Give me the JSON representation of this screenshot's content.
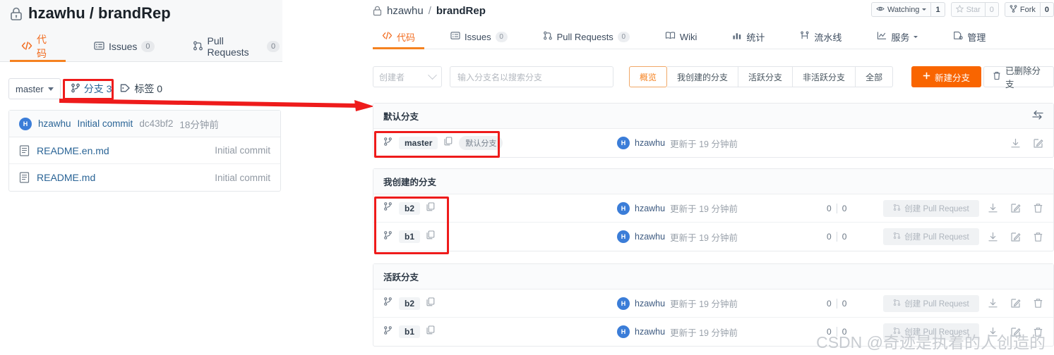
{
  "left_panel": {
    "title": "hzawhu / brandRep",
    "lock_icon": "lock-icon",
    "tabs": [
      {
        "label": "代码",
        "icon": "code-icon",
        "count": null,
        "active": true
      },
      {
        "label": "Issues",
        "icon": "issues-icon",
        "count": "0",
        "active": false
      },
      {
        "label": "Pull Requests",
        "icon": "pull-request-icon",
        "count": "0",
        "active": false
      }
    ],
    "toolbar": {
      "branch_select": "master",
      "branches_label": "分支 3",
      "tags_label": "标签 0"
    },
    "commit_row": {
      "avatar_initial": "H",
      "author": "hzawhu",
      "message": "Initial commit",
      "hash": "dc43bf2",
      "time": "18分钟前"
    },
    "files": [
      {
        "name": "README.en.md",
        "message": "Initial commit",
        "icon": "file-icon"
      },
      {
        "name": "README.md",
        "message": "Initial commit",
        "icon": "file-icon"
      }
    ]
  },
  "right_panel": {
    "breadcrumb": {
      "owner": "hzawhu",
      "separator": "/",
      "repo": "brandRep",
      "lock_icon": "lock-icon"
    },
    "actions": [
      {
        "label": "Watching",
        "count": "1",
        "icon": "eye-icon",
        "dim": false
      },
      {
        "label": "Star",
        "count": "0",
        "icon": "star-icon",
        "dim": true
      },
      {
        "label": "Fork",
        "count": "0",
        "icon": "fork-icon",
        "dim": false
      }
    ],
    "tabs": [
      {
        "label": "代码",
        "icon": "code-icon",
        "count": null,
        "active": true
      },
      {
        "label": "Issues",
        "icon": "issues-icon",
        "count": "0",
        "active": false
      },
      {
        "label": "Pull Requests",
        "icon": "pull-request-icon",
        "count": "0",
        "active": false
      },
      {
        "label": "Wiki",
        "icon": "book-icon",
        "count": null,
        "active": false
      },
      {
        "label": "统计",
        "icon": "chart-icon",
        "count": null,
        "active": false
      },
      {
        "label": "流水线",
        "icon": "pipeline-icon",
        "count": null,
        "active": false
      },
      {
        "label": "服务",
        "icon": "service-icon",
        "count": null,
        "active": false,
        "caret": true
      },
      {
        "label": "管理",
        "icon": "manage-icon",
        "count": null,
        "active": false
      }
    ],
    "filters": {
      "creator_placeholder": "创建者",
      "search_placeholder": "输入分支名以搜索分支",
      "seg_tabs": [
        {
          "label": "概览",
          "selected": true
        },
        {
          "label": "我创建的分支",
          "selected": false
        },
        {
          "label": "活跃分支",
          "selected": false
        },
        {
          "label": "非活跃分支",
          "selected": false
        },
        {
          "label": "全部",
          "selected": false
        }
      ],
      "new_branch_label": "新建分支",
      "new_branch_icon": "plus-icon",
      "deleted_branch_label": "已删除分支",
      "deleted_branch_icon": "trash-icon"
    },
    "sections": [
      {
        "title": "默认分支",
        "has_compare_icon": true,
        "compare_icon": "compare-arrows-icon",
        "rows": [
          {
            "branch": "master",
            "is_default": true,
            "default_tag": "默认分支",
            "copy_icon": "copy-icon",
            "branch_icon": "branch-icon",
            "avatar_initial": "H",
            "author": "hzawhu",
            "updated": "更新于 19 分钟前",
            "ahead": null,
            "behind": null,
            "pr_button": null,
            "icons": [
              "download-icon",
              "edit-icon"
            ]
          }
        ]
      },
      {
        "title": "我创建的分支",
        "has_compare_icon": false,
        "rows": [
          {
            "branch": "b2",
            "is_default": false,
            "copy_icon": "copy-icon",
            "branch_icon": "branch-icon",
            "avatar_initial": "H",
            "author": "hzawhu",
            "updated": "更新于 19 分钟前",
            "ahead": "0",
            "behind": "0",
            "pr_button": "创建 Pull Request",
            "pr_icon": "pull-request-icon",
            "icons": [
              "download-icon",
              "edit-icon",
              "trash-icon"
            ]
          },
          {
            "branch": "b1",
            "is_default": false,
            "copy_icon": "copy-icon",
            "branch_icon": "branch-icon",
            "avatar_initial": "H",
            "author": "hzawhu",
            "updated": "更新于 19 分钟前",
            "ahead": "0",
            "behind": "0",
            "pr_button": "创建 Pull Request",
            "pr_icon": "pull-request-icon",
            "icons": [
              "download-icon",
              "edit-icon",
              "trash-icon"
            ]
          }
        ]
      },
      {
        "title": "活跃分支",
        "has_compare_icon": false,
        "rows": [
          {
            "branch": "b2",
            "is_default": false,
            "copy_icon": "copy-icon",
            "branch_icon": "branch-icon",
            "avatar_initial": "H",
            "author": "hzawhu",
            "updated": "更新于 19 分钟前",
            "ahead": "0",
            "behind": "0",
            "pr_button": "创建 Pull Request",
            "pr_icon": "pull-request-icon",
            "icons": [
              "download-icon",
              "edit-icon",
              "trash-icon"
            ]
          },
          {
            "branch": "b1",
            "is_default": false,
            "copy_icon": "copy-icon",
            "branch_icon": "branch-icon",
            "avatar_initial": "H",
            "author": "hzawhu",
            "updated": "更新于 19 分钟前",
            "ahead": "0",
            "behind": "0",
            "pr_button": "创建 Pull Request",
            "pr_icon": "pull-request-icon",
            "icons": [
              "download-icon",
              "edit-icon",
              "trash-icon"
            ]
          }
        ]
      }
    ]
  },
  "annotations": {
    "arrow_color": "#ee1b1b",
    "highlight_color": "#ee1b1b"
  },
  "watermark": "CSDN @奇迹是执着的人创造的"
}
